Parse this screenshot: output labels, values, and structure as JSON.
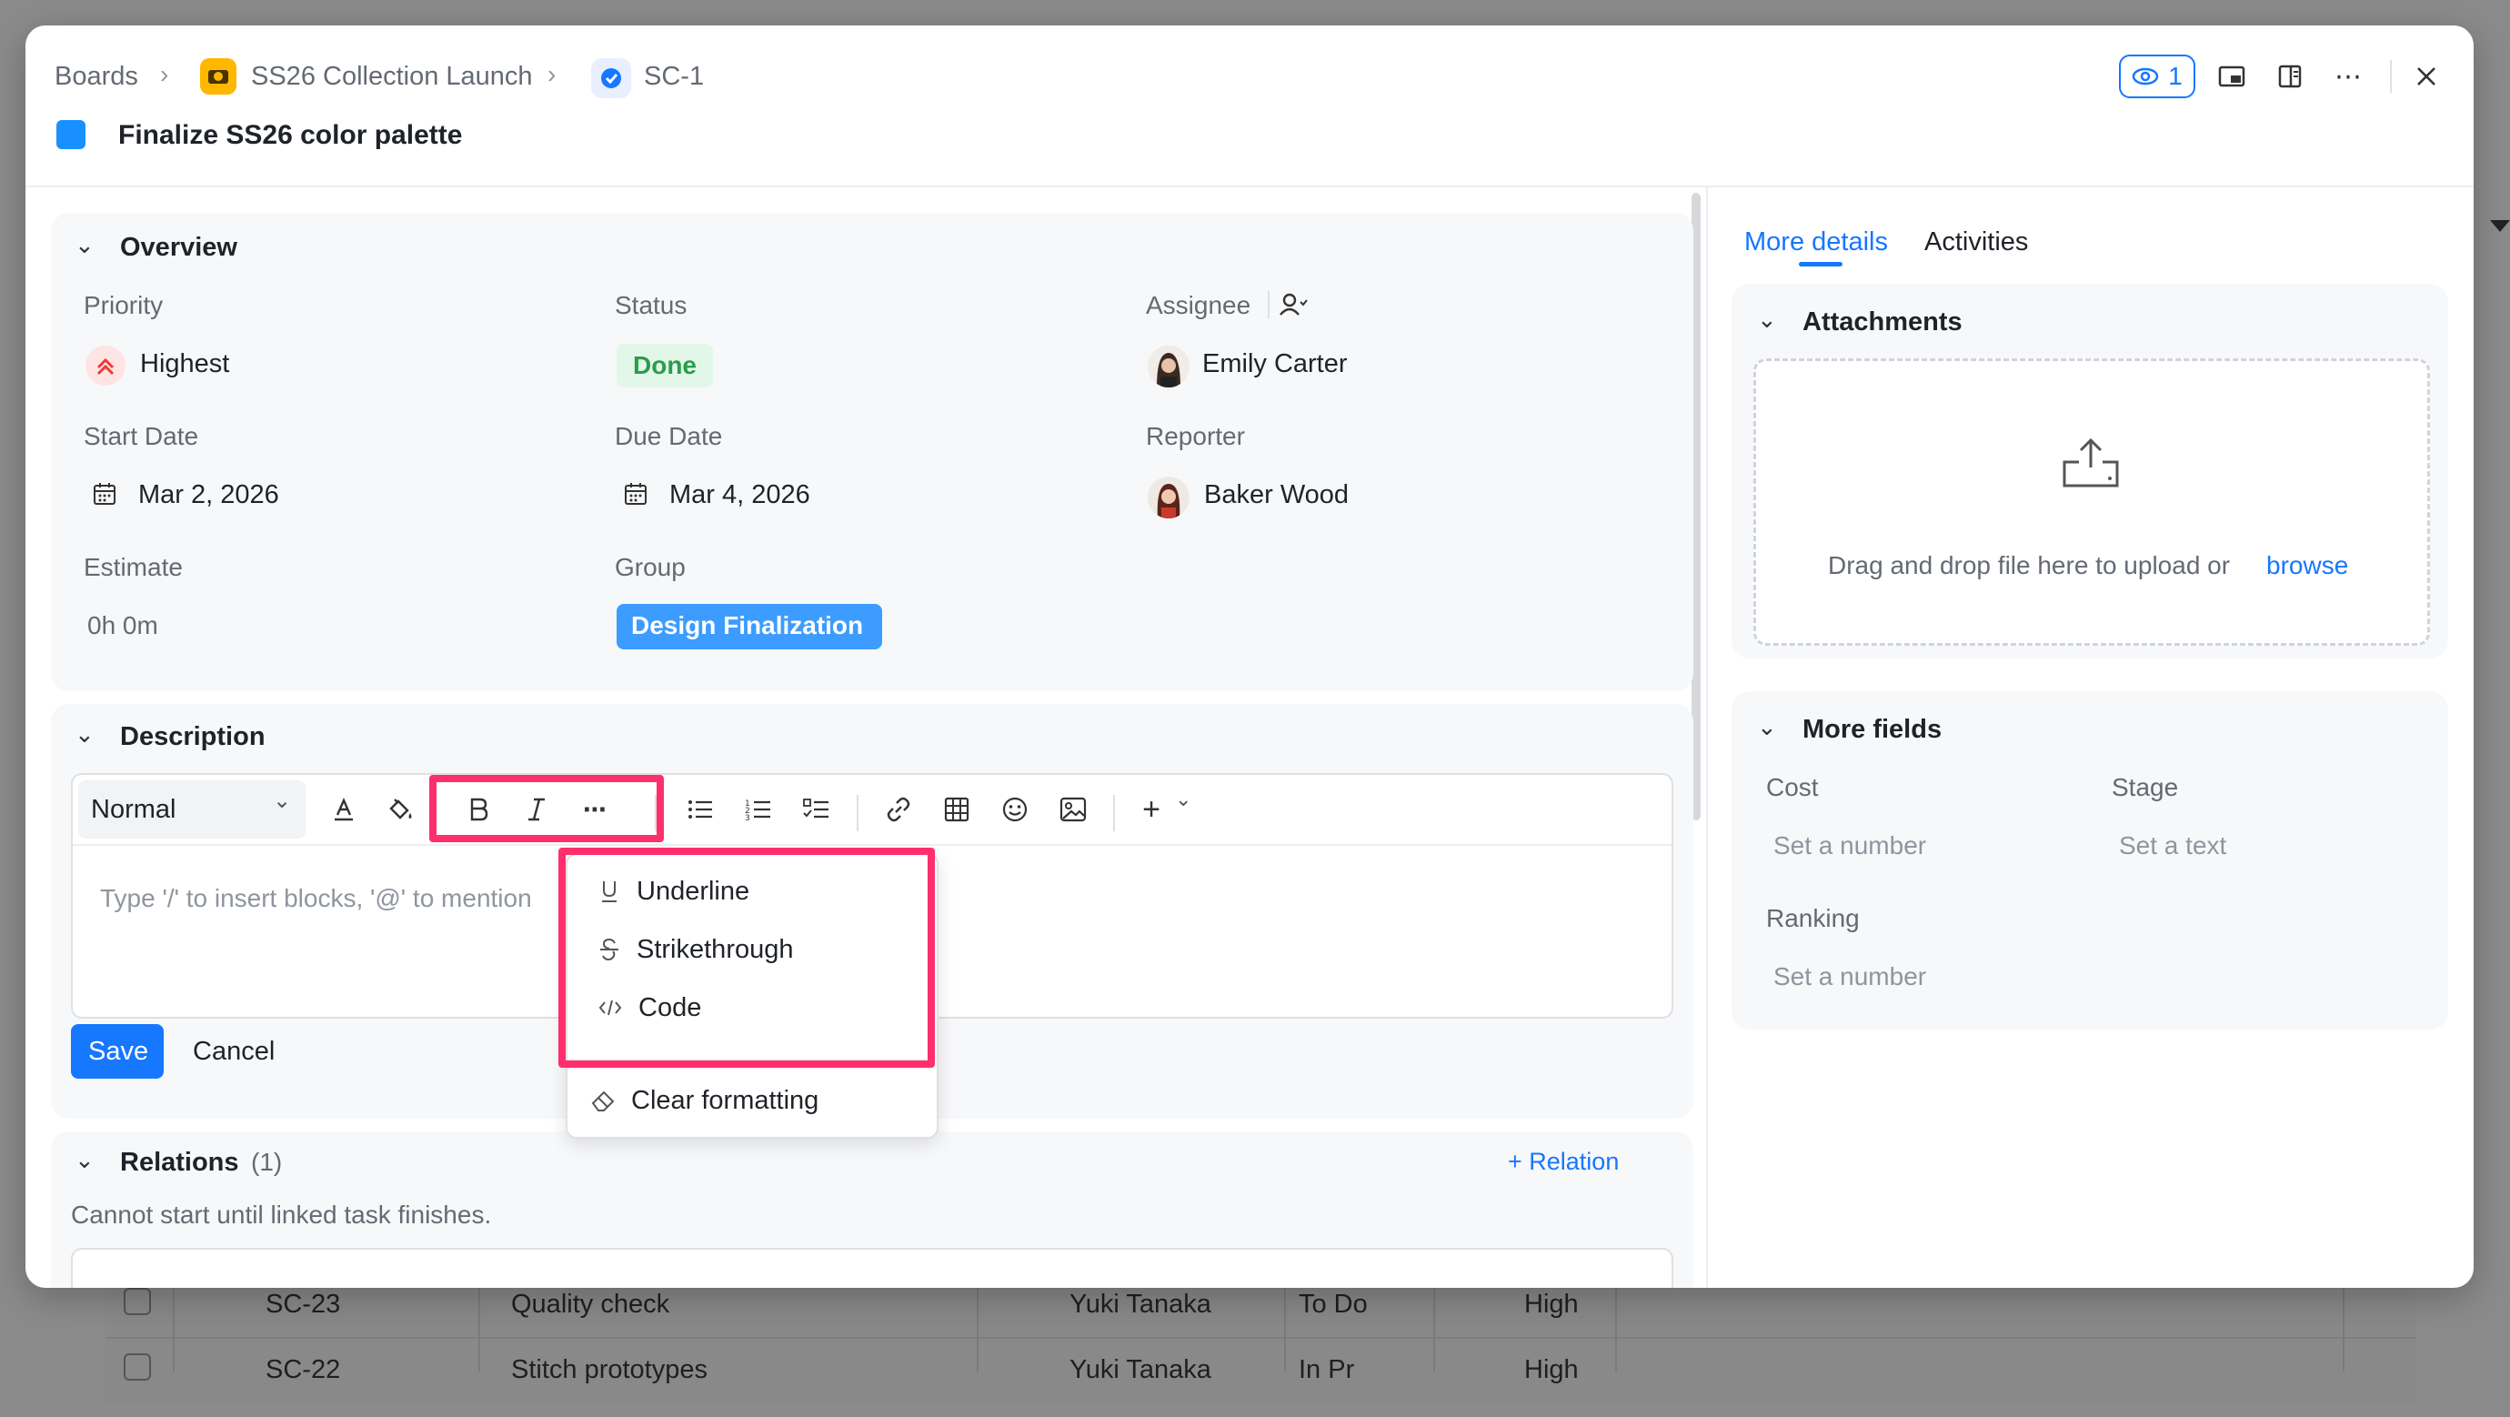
{
  "breadcrumb": {
    "root": "Boards",
    "project": "SS26 Collection Launch",
    "task_id": "SC-1"
  },
  "header": {
    "task_title": "Finalize SS26 color palette",
    "watchers_count": "1"
  },
  "overview": {
    "section_title": "Overview",
    "priority_label": "Priority",
    "priority_value": "Highest",
    "status_label": "Status",
    "status_value": "Done",
    "assignee_label": "Assignee",
    "assignee_value": "Emily Carter",
    "start_date_label": "Start Date",
    "start_date_value": "Mar 2, 2026",
    "due_date_label": "Due Date",
    "due_date_value": "Mar 4, 2026",
    "reporter_label": "Reporter",
    "reporter_value": "Baker Wood",
    "estimate_label": "Estimate",
    "estimate_value": "0h 0m",
    "group_label": "Group",
    "group_value": "Design Finalization"
  },
  "description": {
    "section_title": "Description",
    "text_style": "Normal",
    "placeholder": "Type '/' to insert blocks, '@' to mention",
    "save_label": "Save",
    "cancel_label": "Cancel"
  },
  "format_menu": {
    "items": [
      "Underline",
      "Strikethrough",
      "Code"
    ],
    "clear_label": "Clear formatting"
  },
  "relations": {
    "section_title": "Relations",
    "count": "(1)",
    "add_label": "+ Relation",
    "note": "Cannot start until linked task finishes."
  },
  "side_panel": {
    "tabs": [
      "More details",
      "Activities"
    ],
    "attachments_title": "Attachments",
    "upload_text": "Drag and drop file here to upload or",
    "browse_label": "browse",
    "more_fields_title": "More fields",
    "cost_label": "Cost",
    "cost_value": "Set a number",
    "stage_label": "Stage",
    "stage_value": "Set a text",
    "ranking_label": "Ranking",
    "ranking_value": "Set a number"
  },
  "background_table": {
    "rows": [
      {
        "id": "SC-23",
        "name": "Quality check",
        "assignee": "Yuki Tanaka",
        "status": "To Do",
        "priority": "High"
      },
      {
        "id": "SC-22",
        "name": "Stitch prototypes",
        "assignee": "Yuki Tanaka",
        "status": "In Pr",
        "priority": "High"
      }
    ]
  },
  "colors": {
    "accent": "#1677ff",
    "task_color": "#1890ff",
    "done_bg": "#e3f7e8",
    "done_text": "#2a9d4b",
    "group_bg": "#3c9cff",
    "highlight": "#ff2e6c"
  }
}
